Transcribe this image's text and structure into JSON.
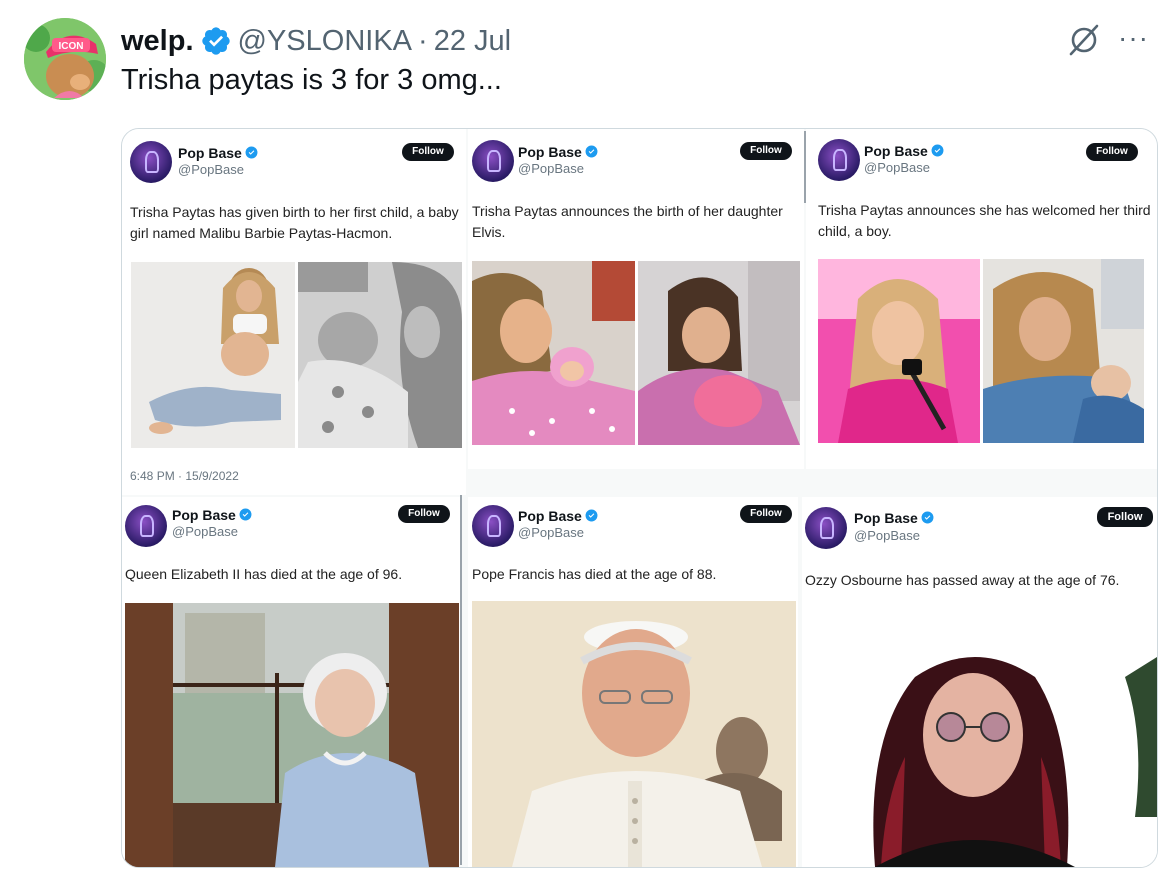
{
  "tweet": {
    "display_name": "welp.",
    "handle": "@YSLONIKA",
    "separator": "·",
    "date": "22 Jul",
    "text": "Trisha paytas is 3 for 3 omg...",
    "more_label": "···",
    "avatar_cap_text": "ICON"
  },
  "cards": [
    {
      "name": "Pop Base",
      "handle": "@PopBase",
      "follow": "Follow",
      "text": "Trisha Paytas has given birth to her first child, a baby girl named Malibu Barbie Paytas-Hacmon.",
      "timestamp": "6:48 PM · 15/9/2022"
    },
    {
      "name": "Pop Base",
      "handle": "@PopBase",
      "follow": "Follow",
      "text": "Trisha Paytas announces the birth of her daughter Elvis."
    },
    {
      "name": "Pop Base",
      "handle": "@PopBase",
      "follow": "Follow",
      "text": "Trisha Paytas announces she has welcomed her third child, a boy."
    },
    {
      "name": "Pop Base",
      "handle": "@PopBase",
      "follow": "Follow",
      "text": "Queen Elizabeth II has died at the age of 96."
    },
    {
      "name": "Pop Base",
      "handle": "@PopBase",
      "follow": "Follow",
      "text": "Pope Francis has died at the age of 88."
    },
    {
      "name": "Pop Base",
      "handle": "@PopBase",
      "follow": "Follow",
      "text": "Ozzy Osbourne has passed away at the age  of 76."
    }
  ],
  "colors": {
    "verified": "#1d9bf0",
    "text_primary": "#0f1419",
    "text_secondary": "#536471",
    "border": "#cfd9de"
  },
  "icons": [
    "verified-badge-icon",
    "grok-icon",
    "more-icon",
    "pop-base-avatar-icon"
  ]
}
